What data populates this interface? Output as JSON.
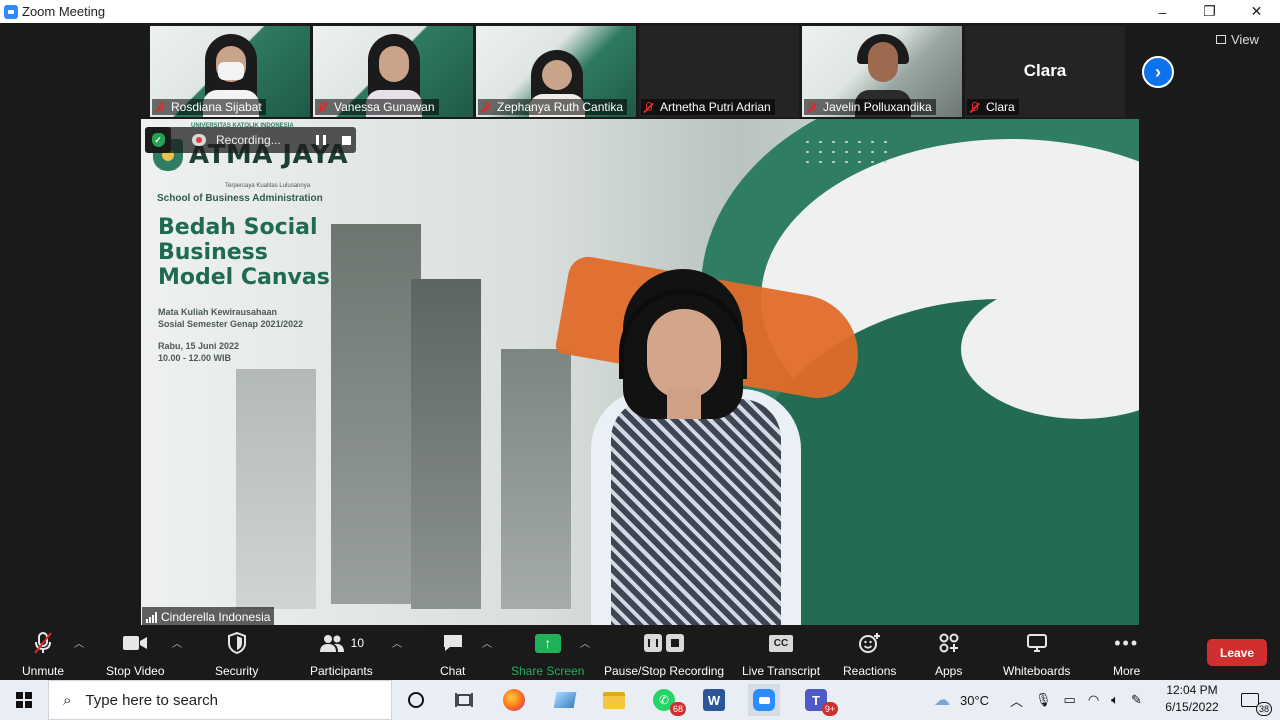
{
  "window": {
    "title": "Zoom Meeting",
    "minimize": "–",
    "maximize": "❐",
    "close": "✕"
  },
  "gallery": {
    "view_label": "View",
    "participants": [
      {
        "name": "Rosdiana Sijabat",
        "muted": true,
        "mask": true
      },
      {
        "name": "Vanessa Gunawan",
        "muted": true
      },
      {
        "name": "Zephanya Ruth Cantika",
        "muted": true
      },
      {
        "name": "Artnetha Putri Adrian",
        "muted": true,
        "video_off": true
      },
      {
        "name": "Javelin Polluxandika",
        "muted": true
      },
      {
        "name": "Clara",
        "muted": true,
        "video_off": true,
        "center_name": "Clara"
      }
    ]
  },
  "main_video": {
    "speaker_name": "Cinderella Indonesia",
    "slide": {
      "logo_title": "ATMA JAYA",
      "logo_university": "UNIVERSITAS KATOLIK INDONESIA",
      "logo_tagline": "Terpercaya Kualitas Lulusannya",
      "school": "School of Business Administration",
      "headline": [
        "Bedah Social",
        "Business",
        "Model Canvas"
      ],
      "course": [
        "Mata Kuliah Kewirausahaan",
        "Sosial Semester Genap 2021/2022"
      ],
      "date": [
        "Rabu, 15 Juni 2022",
        "10.00 - 12.00 WIB"
      ]
    },
    "recording": {
      "label": "Recording..."
    }
  },
  "toolbar": {
    "unmute": "Unmute",
    "stop_video": "Stop Video",
    "security": "Security",
    "participants": "Participants",
    "participants_count": "10",
    "chat": "Chat",
    "share_screen": "Share Screen",
    "pause_stop_recording": "Pause/Stop Recording",
    "live_transcript": "Live Transcript",
    "cc": "CC",
    "reactions": "Reactions",
    "apps": "Apps",
    "whiteboards": "Whiteboards",
    "more": "More",
    "leave": "Leave",
    "share_color": "#20b15a",
    "leave_color": "#d12f2f"
  },
  "taskbar": {
    "search_placeholder": "Type here to search",
    "whatsapp_badge": "68",
    "teams_badge": "9+",
    "temperature": "30°C",
    "time": "12:04 PM",
    "date": "6/15/2022",
    "notifications": "38"
  }
}
